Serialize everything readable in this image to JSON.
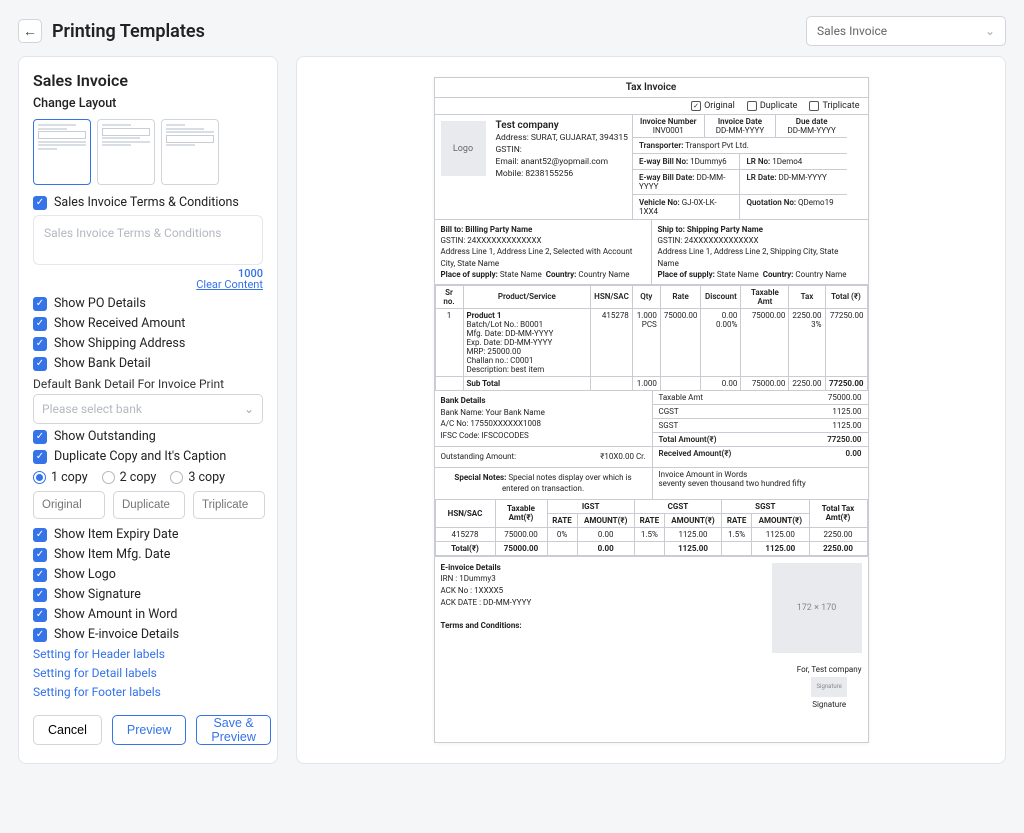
{
  "topbar": {
    "title": "Printing Templates",
    "selector": "Sales Invoice"
  },
  "left": {
    "title": "Sales Invoice",
    "changeLayout": "Change Layout",
    "opts": {
      "terms": "Sales Invoice Terms & Conditions",
      "po": "Show PO Details",
      "received": "Show Received Amount",
      "shipping": "Show Shipping Address",
      "bank": "Show Bank Detail",
      "bankDefault": "Default Bank Detail For Invoice Print",
      "bankPlaceholder": "Please select bank",
      "outstanding": "Show Outstanding",
      "duplicate": "Duplicate Copy and It's Caption",
      "copy1": "1 copy",
      "copy2": "2 copy",
      "copy3": "3 copy",
      "original": "Original",
      "duplicateIn": "Duplicate",
      "triplicate": "Triplicate",
      "expiry": "Show Item Expiry Date",
      "mfg": "Show Item Mfg. Date",
      "logo": "Show Logo",
      "signature": "Show Signature",
      "amountWord": "Show Amount in Word",
      "einvoice": "Show E-invoice Details",
      "header": "Setting for Header labels",
      "detail": "Setting for Detail labels",
      "footer": "Setting for Footer labels"
    },
    "terms": {
      "placeholder": "Sales Invoice Terms & Conditions",
      "count": "1000",
      "clear": "Clear Content"
    },
    "btns": {
      "cancel": "Cancel",
      "preview": "Preview",
      "save": "Save & Preview"
    }
  },
  "doc": {
    "title": "Tax Invoice",
    "copies": {
      "original": "Original",
      "duplicate": "Duplicate",
      "triplicate": "Triplicate"
    },
    "logo": "Logo",
    "company": {
      "name": "Test company",
      "addr": "Address: SURAT, GUJARAT, 394315",
      "gstinLabel": "GSTIN:",
      "email": "Email: anant52@yopmail.com",
      "mobile": "Mobile: 8238155256"
    },
    "meta": {
      "invNoLabel": "Invoice Number",
      "invNo": "INV0001",
      "invDateLabel": "Invoice Date",
      "invDate": "DD-MM-YYYY",
      "dueLabel": "Due date",
      "due": "DD-MM-YYYY",
      "transporter": "Transporter: Transport Pvt Ltd.",
      "ewayNo": "E-way Bill No: 1Dummy6",
      "lrNo": "LR No: 1Demo4",
      "ewayDate": "E-way Bill Date: DD-MM-YYYY",
      "lrDate": "LR Date: DD-MM-YYYY",
      "vehicle": "Vehicle No: GJ-0X-LK-1XX4",
      "quotation": "Quotation No: QDemo19"
    },
    "bill": {
      "title": "Bill to: Billing Party Name",
      "gstin": "GSTIN: 24XXXXXXXXXXXXX",
      "addr": "Address Line 1, Address Line 2, Selected with Account City, State Name",
      "place": "Place of supply: State Name  Country: Country Name"
    },
    "ship": {
      "title": "Ship to: Shipping Party Name",
      "gstin": "GSTIN: 24XXXXXXXXXXXXX",
      "addr": "Address Line 1, Address Line 2, Shipping City, State Name",
      "place": "Place of supply: State Name  Country: Country Name"
    },
    "th": {
      "sr": "Sr no.",
      "prod": "Product/Service",
      "hsn": "HSN/SAC",
      "qty": "Qty",
      "rate": "Rate",
      "disc": "Discount",
      "tax": "Taxable Amt",
      "taxCol": "Tax",
      "total": "Total (₹)"
    },
    "item": {
      "sr": "1",
      "name": "Product 1",
      "d1": "Batch/Lot No.: B0001",
      "d2": "Mfg. Date: DD-MM-YYYY",
      "d3": "Exp. Date: DD-MM-YYYY",
      "d4": "MRP: 25000.00",
      "d5": "Challan no.: C0001",
      "d6": "Description: best item",
      "hsn": "415278",
      "qty": "1.000",
      "qtyUnit": "PCS",
      "rate": "75000.00",
      "disc": "0.00",
      "discP": "0.00%",
      "taxAmt": "75000.00",
      "taxVal": "2250.00",
      "taxP": "3%",
      "total": "77250.00"
    },
    "subTotal": {
      "label": "Sub Total",
      "qty": "1.000",
      "disc": "0.00",
      "taxAmt": "75000.00",
      "tax": "2250.00",
      "total": "77250.00"
    },
    "bank": {
      "title": "Bank Details",
      "name": "Bank Name: Your Bank Name",
      "ac": "A/C No: 17550XXXXXX1008",
      "ifsc": "IFSC Code: IFSCOCODES"
    },
    "amounts": {
      "taxable": "Taxable Amt",
      "taxableV": "75000.00",
      "cgst": "CGST",
      "cgstV": "1125.00",
      "sgst": "SGST",
      "sgstV": "1125.00",
      "totalAmt": "Total Amount(₹)",
      "totalAmtV": "77250.00",
      "received": "Received Amount(₹)",
      "receivedV": "0.00",
      "words": "Invoice Amount in Words",
      "wordsV": "seventy seven thousand two hundred fifty"
    },
    "outstanding": {
      "label": "Outstanding Amount:",
      "value": "₹10X0.00 Cr."
    },
    "special": {
      "label": "Special Notes:",
      "text": "Special notes display over which is entered on transaction."
    },
    "taxT": {
      "hsn": "HSN/SAC",
      "taxable": "Taxable Amt(₹)",
      "igst": "IGST",
      "cgst": "CGST",
      "sgst": "SGST",
      "rate": "RATE",
      "amount": "AMOUNT(₹)",
      "totTax": "Total Tax Amt(₹)",
      "rowHsn": "415278",
      "rowTaxable": "75000.00",
      "igstR": "0%",
      "igstA": "0.00",
      "cgstR": "1.5%",
      "cgstA": "1125.00",
      "sgstR": "1.5%",
      "sgstA": "1125.00",
      "rowTotTax": "2250.00",
      "totalLabel": "Total(₹)"
    },
    "einv": {
      "title": "E-invoice Details",
      "irn": "IRN : 1Dummy3",
      "ack": "ACK No : 1XXXX5",
      "ackDate": "ACK DATE : DD-MM-YYYY",
      "tc": "Terms and Conditions:"
    },
    "placeholderImg": "172 × 170",
    "sig": {
      "for": "For, Test company",
      "box": "Signature",
      "label": "Signature"
    }
  }
}
